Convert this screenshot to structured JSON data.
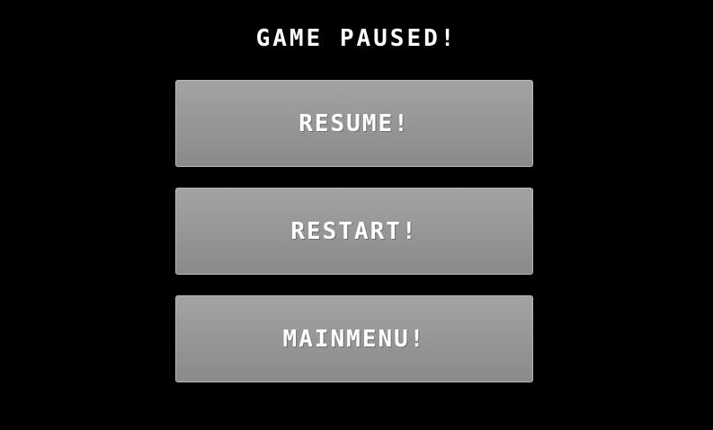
{
  "pause_menu": {
    "title": "GAME PAUSED!",
    "buttons": {
      "resume": "RESUME!",
      "restart": "RESTART!",
      "main_menu": "MAINMENU!"
    }
  },
  "colors": {
    "background": "#000000",
    "button_gradient_top": "#a3a3a3",
    "button_gradient_bottom": "#8a8a8a",
    "text": "#ffffff"
  }
}
